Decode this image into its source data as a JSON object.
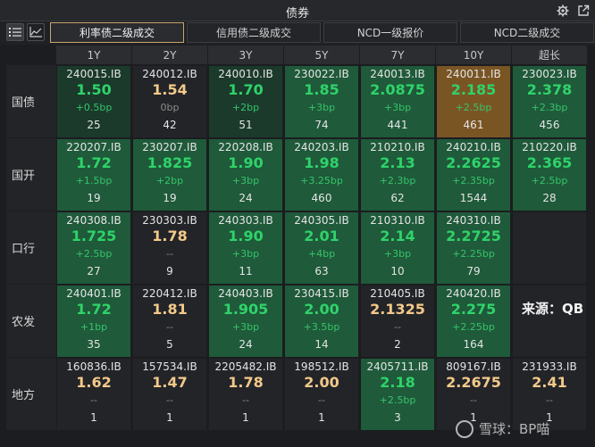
{
  "window": {
    "title": "债券"
  },
  "icons": {
    "settings": "gear-icon",
    "popout": "popout-icon",
    "list_view": "list-icon",
    "chart_view": "line-chart-icon"
  },
  "tabs": [
    {
      "label": "利率债二级成交",
      "active": true
    },
    {
      "label": "信用债二级成交",
      "active": false
    },
    {
      "label": "NCD一级报价",
      "active": false
    },
    {
      "label": "NCD二级成交",
      "active": false
    }
  ],
  "columns": [
    "1Y",
    "2Y",
    "3Y",
    "5Y",
    "7Y",
    "10Y",
    "超长"
  ],
  "rows": [
    {
      "label": "国债",
      "cells": [
        {
          "code": "240015.IB",
          "yield": "1.50",
          "change": "+0.5bp",
          "volume": "25",
          "style": "dgreen",
          "ycolor": "green"
        },
        {
          "code": "240012.IB",
          "yield": "1.54",
          "change": "0bp",
          "volume": "42",
          "style": "dark",
          "ycolor": "orange"
        },
        {
          "code": "240010.IB",
          "yield": "1.70",
          "change": "+2bp",
          "volume": "51",
          "style": "dgreen",
          "ycolor": "green"
        },
        {
          "code": "230022.IB",
          "yield": "1.85",
          "change": "+3bp",
          "volume": "74",
          "style": "green",
          "ycolor": "green"
        },
        {
          "code": "240013.IB",
          "yield": "2.0875",
          "change": "+3bp",
          "volume": "441",
          "style": "green",
          "ycolor": "green"
        },
        {
          "code": "240011.IB",
          "yield": "2.185",
          "change": "+2.5bp",
          "volume": "461",
          "style": "orange",
          "ycolor": "green"
        },
        {
          "code": "230023.IB",
          "yield": "2.378",
          "change": "+2.3bp",
          "volume": "456",
          "style": "green",
          "ycolor": "green"
        }
      ]
    },
    {
      "label": "国开",
      "cells": [
        {
          "code": "220207.IB",
          "yield": "1.72",
          "change": "+1.5bp",
          "volume": "19",
          "style": "green",
          "ycolor": "green"
        },
        {
          "code": "230207.IB",
          "yield": "1.825",
          "change": "+2bp",
          "volume": "19",
          "style": "green",
          "ycolor": "green"
        },
        {
          "code": "220208.IB",
          "yield": "1.90",
          "change": "+3bp",
          "volume": "24",
          "style": "green",
          "ycolor": "green"
        },
        {
          "code": "240203.IB",
          "yield": "1.98",
          "change": "+3.25bp",
          "volume": "460",
          "style": "green",
          "ycolor": "green"
        },
        {
          "code": "210210.IB",
          "yield": "2.13",
          "change": "+2.3bp",
          "volume": "62",
          "style": "green",
          "ycolor": "green"
        },
        {
          "code": "240210.IB",
          "yield": "2.2625",
          "change": "+2.35bp",
          "volume": "1544",
          "style": "green",
          "ycolor": "green"
        },
        {
          "code": "210220.IB",
          "yield": "2.365",
          "change": "+2.5bp",
          "volume": "28",
          "style": "green",
          "ycolor": "green"
        }
      ]
    },
    {
      "label": "口行",
      "cells": [
        {
          "code": "240308.IB",
          "yield": "1.725",
          "change": "+2.5bp",
          "volume": "27",
          "style": "green",
          "ycolor": "green"
        },
        {
          "code": "230303.IB",
          "yield": "1.78",
          "change": "--",
          "volume": "9",
          "style": "dark",
          "ycolor": "orange"
        },
        {
          "code": "240303.IB",
          "yield": "1.90",
          "change": "+3bp",
          "volume": "11",
          "style": "green",
          "ycolor": "green"
        },
        {
          "code": "240305.IB",
          "yield": "2.01",
          "change": "+4bp",
          "volume": "63",
          "style": "green",
          "ycolor": "green"
        },
        {
          "code": "210310.IB",
          "yield": "2.14",
          "change": "+3bp",
          "volume": "10",
          "style": "green",
          "ycolor": "green"
        },
        {
          "code": "240310.IB",
          "yield": "2.2725",
          "change": "+2.25bp",
          "volume": "79",
          "style": "green",
          "ycolor": "green"
        }
      ]
    },
    {
      "label": "农发",
      "cells": [
        {
          "code": "240401.IB",
          "yield": "1.72",
          "change": "+1bp",
          "volume": "35",
          "style": "green",
          "ycolor": "green"
        },
        {
          "code": "220412.IB",
          "yield": "1.81",
          "change": "--",
          "volume": "5",
          "style": "dark",
          "ycolor": "orange"
        },
        {
          "code": "240403.IB",
          "yield": "1.905",
          "change": "+3bp",
          "volume": "24",
          "style": "green",
          "ycolor": "green"
        },
        {
          "code": "230415.IB",
          "yield": "2.00",
          "change": "+3.5bp",
          "volume": "14",
          "style": "green",
          "ycolor": "green"
        },
        {
          "code": "210405.IB",
          "yield": "2.1325",
          "change": "--",
          "volume": "2",
          "style": "dark",
          "ycolor": "orange"
        },
        {
          "code": "240420.IB",
          "yield": "2.275",
          "change": "+2.25bp",
          "volume": "164",
          "style": "green",
          "ycolor": "green"
        }
      ]
    },
    {
      "label": "地方",
      "cells": [
        {
          "code": "160836.IB",
          "yield": "1.62",
          "change": "--",
          "volume": "1",
          "style": "dark",
          "ycolor": "orange"
        },
        {
          "code": "157534.IB",
          "yield": "1.47",
          "change": "--",
          "volume": "1",
          "style": "dark",
          "ycolor": "orange"
        },
        {
          "code": "2205482.IB",
          "yield": "1.78",
          "change": "--",
          "volume": "1",
          "style": "dark",
          "ycolor": "orange"
        },
        {
          "code": "198512.IB",
          "yield": "2.00",
          "change": "--",
          "volume": "1",
          "style": "dark",
          "ycolor": "orange"
        },
        {
          "code": "2405711.IB",
          "yield": "2.18",
          "change": "+2.5bp",
          "volume": "3",
          "style": "green",
          "ycolor": "green"
        },
        {
          "code": "809167.IB",
          "yield": "2.2675",
          "change": "--",
          "volume": "1",
          "style": "dark",
          "ycolor": "orange"
        },
        {
          "code": "231933.IB",
          "yield": "2.41",
          "change": "--",
          "volume": "1",
          "style": "dark",
          "ycolor": "orange"
        }
      ]
    }
  ],
  "source_note": "来源：QB",
  "watermark": "雪球：BP喵",
  "colors": {
    "accent_tab": "#c9a56a",
    "up_green": "#2fd36a",
    "flat_orange": "#f3c98a",
    "cell_green": "#1f5a3a",
    "cell_highlight": "#7a5524"
  }
}
